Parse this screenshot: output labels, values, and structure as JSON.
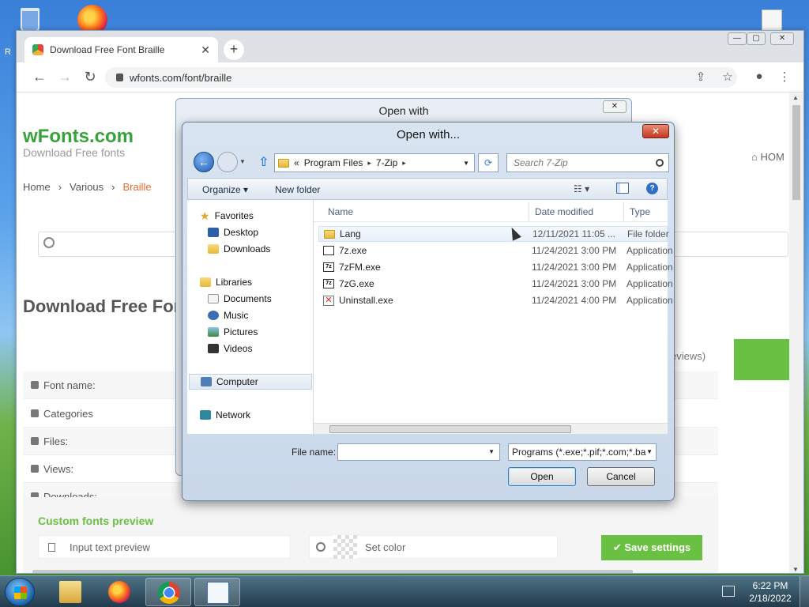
{
  "desktop": {
    "file_label": "...",
    "left_letter": "R"
  },
  "browser": {
    "tab_title": "Download Free Font Braille",
    "tab_close": "✕",
    "new_tab": "+",
    "url": "wfonts.com/font/braille",
    "win_min": "—",
    "win_max": "▢",
    "win_close": "✕"
  },
  "site": {
    "logo": "wFonts.com",
    "tagline": "Download Free fonts",
    "home": "⌂ HOM",
    "breadcrumb": [
      "Home",
      "›",
      "Various",
      "›",
      "Braille"
    ],
    "h1": "Download Free For",
    "info_rows": [
      "Font name:",
      "Categories",
      "Files:",
      "Views:",
      "Downloads:"
    ],
    "reviews": "eviews)",
    "custom_title": "Custom fonts preview",
    "preview_placeholder": "Input text preview",
    "set_color": "Set color",
    "save_settings": "✔ Save settings"
  },
  "back_dialog": {
    "title": "Open with",
    "close": "✕"
  },
  "dialog": {
    "title": "Open with...",
    "close": "✕",
    "back": "←",
    "path": [
      "«",
      "Program Files",
      "▸",
      "7-Zip",
      "▸"
    ],
    "refresh": "⟳",
    "search_placeholder": "Search 7-Zip",
    "organize": "Organize ▾",
    "new_folder": "New folder",
    "views": "☷ ▾",
    "help": "?",
    "nav": {
      "favorites": "Favorites",
      "desktop": "Desktop",
      "downloads": "Downloads",
      "libraries": "Libraries",
      "documents": "Documents",
      "music": "Music",
      "pictures": "Pictures",
      "videos": "Videos",
      "computer": "Computer",
      "network": "Network"
    },
    "columns": {
      "name": "Name",
      "date": "Date modified",
      "type": "Type"
    },
    "files": [
      {
        "name": "Lang",
        "date": "12/11/2021 11:05 ...",
        "type": "File folder",
        "icon": "folder-icon"
      },
      {
        "name": "7z.exe",
        "date": "11/24/2021 3:00 PM",
        "type": "Application",
        "icon": "exe-icon"
      },
      {
        "name": "7zFM.exe",
        "date": "11/24/2021 3:00 PM",
        "type": "Application",
        "icon": "7z-icon"
      },
      {
        "name": "7zG.exe",
        "date": "11/24/2021 3:00 PM",
        "type": "Application",
        "icon": "7z-icon"
      },
      {
        "name": "Uninstall.exe",
        "date": "11/24/2021 4:00 PM",
        "type": "Application",
        "icon": "uninstall-icon"
      }
    ],
    "exe_icon_label": "7z",
    "file_name_label": "File name:",
    "file_name_value": "",
    "file_type": "Programs (*.exe;*.pif;*.com;*.ba",
    "open": "Open",
    "cancel": "Cancel"
  },
  "taskbar": {
    "time": "6:22 PM",
    "date": "2/18/2022"
  }
}
